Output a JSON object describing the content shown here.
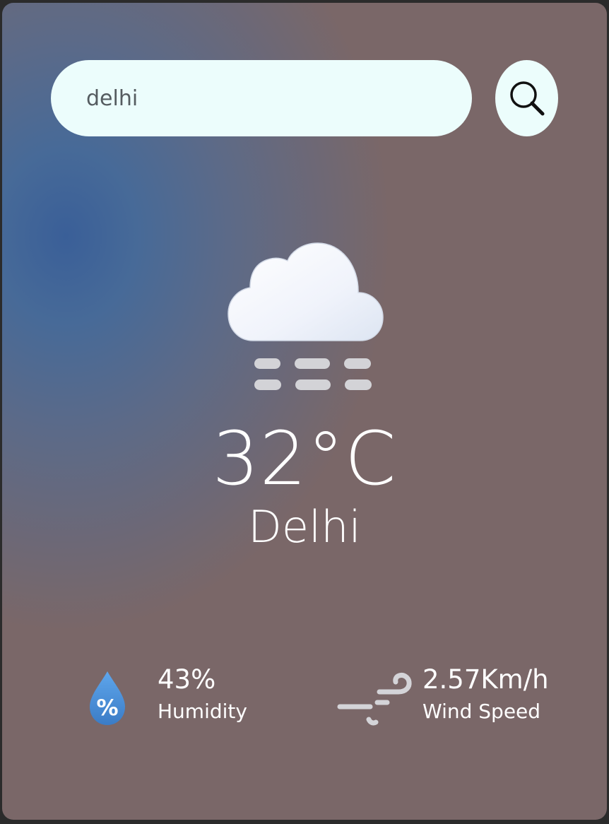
{
  "search": {
    "value": "delhi",
    "button_icon": "search-icon"
  },
  "weather": {
    "icon": "cloud-fog-icon",
    "temperature": "32°C",
    "city": "Delhi"
  },
  "details": {
    "humidity": {
      "icon": "humidity-drop-icon",
      "value": "43%",
      "label": "Humidity",
      "icon_text": "%"
    },
    "wind": {
      "icon": "wind-icon",
      "value": "2.57Km/h",
      "label": "Wind Speed"
    }
  },
  "colors": {
    "input_background": "#ecfdfc",
    "text": "#ffffff",
    "drop": "#4a8fd6"
  }
}
